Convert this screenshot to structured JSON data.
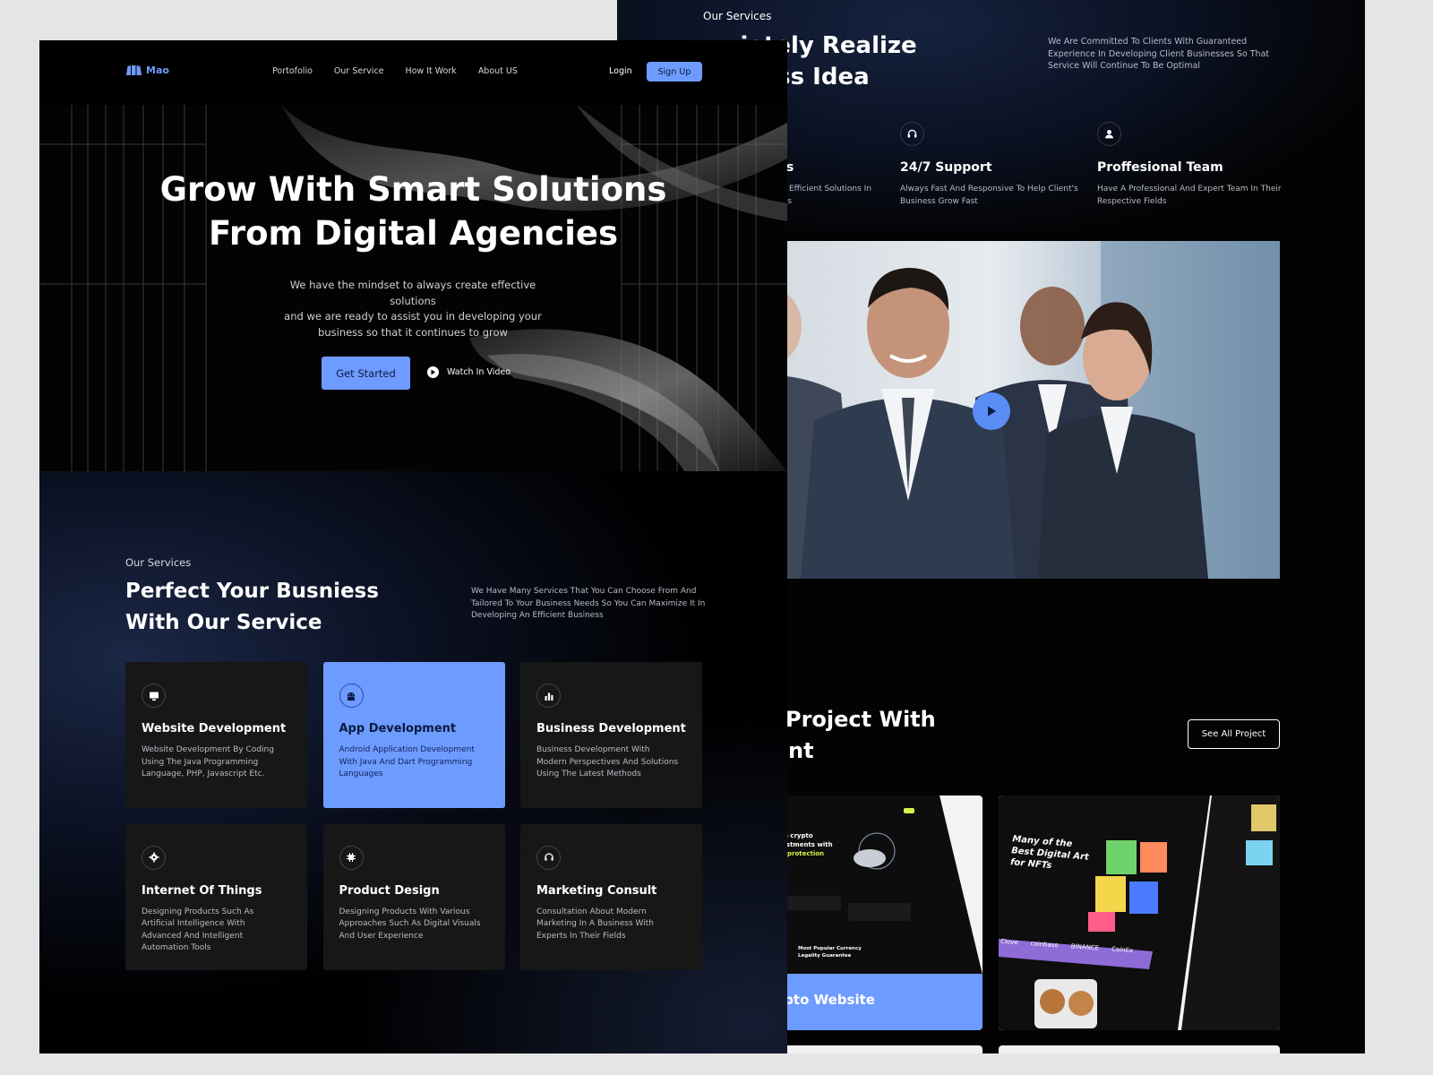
{
  "front": {
    "nav": {
      "logo_text": "Mao",
      "links": [
        "Portofolio",
        "Our Service",
        "How It Work",
        "About US"
      ],
      "login": "Login",
      "signup": "Sign Up"
    },
    "hero": {
      "title_line1": "Grow With Smart Solutions",
      "title_line2": "From Digital Agencies",
      "subtitle_line1": "We have the mindset to always create effective solutions",
      "subtitle_line2": "and we are ready to assist you in developing your",
      "subtitle_line3": "business so that it continues to grow",
      "cta_primary": "Get Started",
      "cta_secondary": "Watch In Video"
    },
    "services": {
      "eyebrow": "Our Services",
      "heading_line1": "Perfect Your Busniess",
      "heading_line2": "With Our Service",
      "description": "We Have Many Services That You Can Choose From And Tailored To Your Business Needs So You Can Maximize It In Developing An Efficient Business",
      "cards": [
        {
          "icon": "monitor-icon",
          "title": "Website Development",
          "desc": "Website Development By Coding Using The Java Programming Language, PHP, Javascript Etc."
        },
        {
          "icon": "android-icon",
          "title": "App Development",
          "desc": "Android Application Development With Java And Dart Programming Languages"
        },
        {
          "icon": "bar-chart-icon",
          "title": "Business Development",
          "desc": "Business Development With Modern Perspectives And Solutions Using The Latest Methods"
        },
        {
          "icon": "cog-icon",
          "title": "Internet Of Things",
          "desc": "Designing Products Such As Artificial Intelligence With Advanced And Intelligent Automation Tools"
        },
        {
          "icon": "chip-icon",
          "title": "Product Design",
          "desc": "Designing Products With Various Approaches Such As Digital Visuals And User Experience"
        },
        {
          "icon": "headset-icon",
          "title": "Marketing Consult",
          "desc": "Consultation About Modern Marketing In A Business With Experts In Their Fields"
        }
      ]
    }
  },
  "back": {
    "eyebrow": "Our Services",
    "heading_line1": "- ...iately Realize",
    "heading_line2": "...siness Idea",
    "description": "We Are Committed To Clients With Guaranteed Experience In Developing Client Businesses So That Service Will Continue To Be Optimal",
    "features": [
      {
        "icon": "",
        "title": "ns",
        "desc_line1": "Efficient Solutions In",
        "desc_line2": "ess"
      },
      {
        "icon": "headset-icon",
        "title": "24/7 Support",
        "desc_line1": "Always Fast And Responsive To Help Client's",
        "desc_line2": "Business Grow Fast"
      },
      {
        "icon": "user-icon",
        "title": "Proffesional Team",
        "desc_line1": "Have A Professional And Expert Team In Their",
        "desc_line2": "Respective Fields"
      }
    ],
    "projects": {
      "heading_line1": "Project With",
      "heading_line2": "nt",
      "see_all": "See All Project",
      "card1_label": "Crypto Website",
      "card1_text1": "Let's crypto",
      "card1_text2": "Investments with",
      "card1_text3": "loss protection",
      "card1_text4": "Most Popular Currency",
      "card1_text5": "Legality Guarantee",
      "card2_text1": "Many of the",
      "card2_text2": "Best Digital Art",
      "card2_text3": "for NFTs",
      "card2_brands": [
        "Clove",
        "coinbase",
        "BINANCE",
        "CoinEx"
      ]
    }
  },
  "colors": {
    "accent": "#6e9bff",
    "page_bg": "#000000",
    "card_bg": "#171717",
    "canvas": "#e5e5e5"
  }
}
